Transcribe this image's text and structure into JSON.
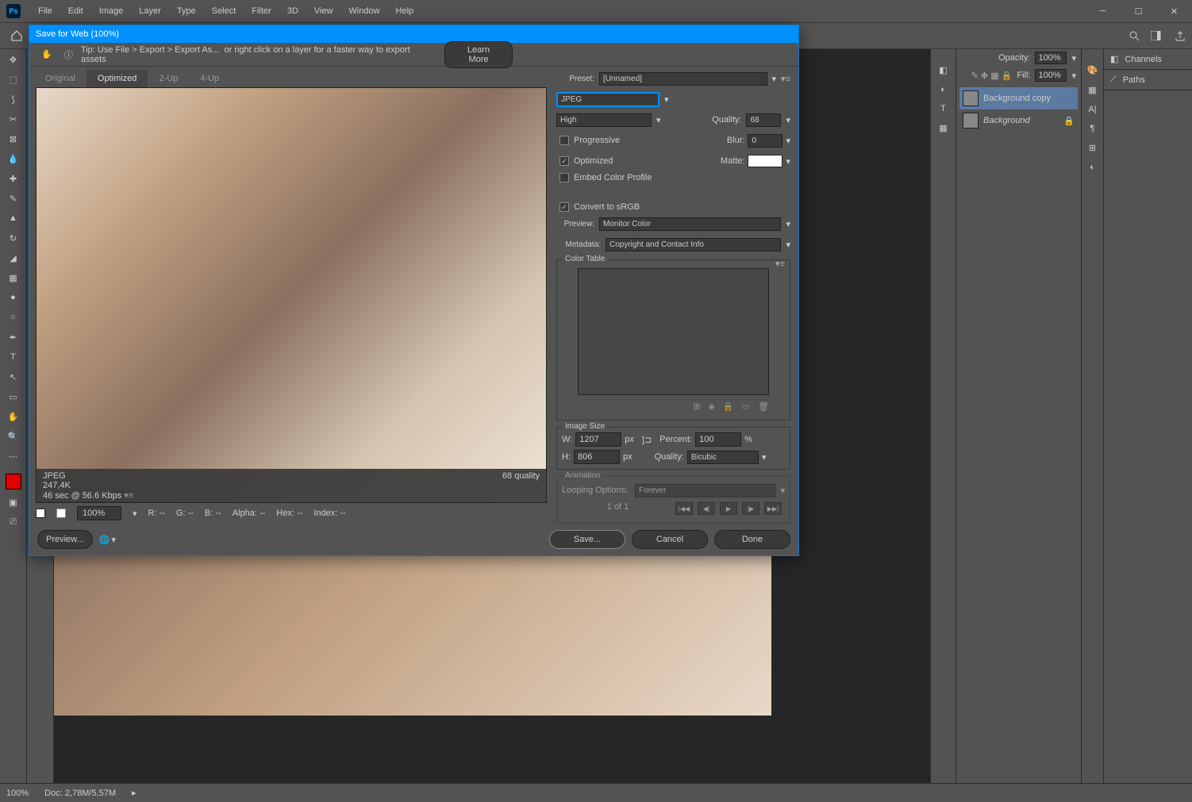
{
  "menubar": {
    "items": [
      "File",
      "Edit",
      "Image",
      "Layer",
      "Type",
      "Select",
      "Filter",
      "3D",
      "View",
      "Window",
      "Help"
    ]
  },
  "dialog": {
    "title": "Save for Web (100%)",
    "tip_prefix": "Tip: Use File > Export > Export As...",
    "tip_suffix": "or right click on a layer for a faster way to export assets",
    "learn_more": "Learn More",
    "tabs": [
      "Original",
      "Optimized",
      "2-Up",
      "4-Up"
    ],
    "active_tab": 1,
    "preview_info": {
      "format": "JPEG",
      "size": "247,4K",
      "time": "46 sec @ 56.6 Kbps",
      "quality": "68 quality"
    },
    "bottom_bar": {
      "zoom": "100%",
      "r": "R: --",
      "g": "G: --",
      "b": "B: --",
      "alpha": "Alpha: --",
      "hex": "Hex: --",
      "index": "Index: --"
    },
    "preset_label": "Preset:",
    "preset_value": "[Unnamed]",
    "format": "JPEG",
    "quality_label": "High",
    "quality_num_label": "Quality:",
    "quality_num": "68",
    "progressive": "Progressive",
    "optimized": "Optimized",
    "embed": "Embed Color Profile",
    "blur_label": "Blur:",
    "blur_val": "0",
    "matte_label": "Matte:",
    "convert_srgb": "Convert to sRGB",
    "preview_label": "Preview:",
    "preview_val": "Monitor Color",
    "metadata_label": "Metadata:",
    "metadata_val": "Copyright and Contact Info",
    "color_table": "Color Table",
    "image_size": "Image Size",
    "w_label": "W:",
    "w_val": "1207",
    "h_label": "H:",
    "h_val": "806",
    "px": "px",
    "percent_label": "Percent:",
    "percent_val": "100",
    "percent_unit": "%",
    "quality_sz_label": "Quality:",
    "quality_sz_val": "Bicubic",
    "animation": "Animation",
    "looping_label": "Looping Options:",
    "looping_val": "Forever",
    "frame_counter": "1 of 1",
    "preview_btn": "Preview...",
    "save_btn": "Save...",
    "cancel_btn": "Cancel",
    "done_btn": "Done"
  },
  "layers_panel": {
    "opacity_label": "Opacity:",
    "opacity_val": "100%",
    "fill_label": "Fill:",
    "fill_val": "100%",
    "layers": [
      {
        "name": "Background copy",
        "locked": false,
        "selected": true
      },
      {
        "name": "Background",
        "locked": true,
        "selected": false
      }
    ]
  },
  "right_tabs": {
    "channels": "Channels",
    "paths": "Paths"
  },
  "status": {
    "zoom": "100%",
    "doc": "Doc: 2,78M/5,57M"
  }
}
